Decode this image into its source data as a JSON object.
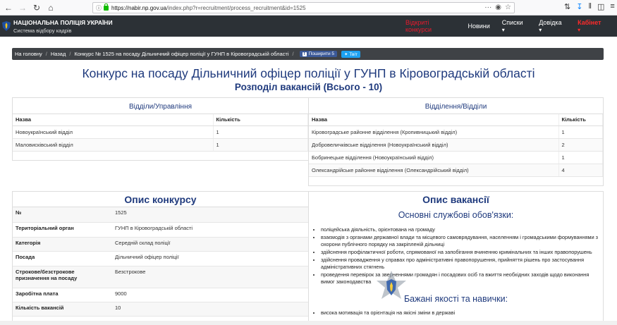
{
  "browser": {
    "url_host": "https://nabir.np.gov.ua",
    "url_path": "/index.php?r=recruitment/process_recruitment&id=1525",
    "url_menu": "···",
    "back_icon": "arrow-left-icon",
    "forward_icon": "arrow-right-icon",
    "reload_icon": "reload-icon",
    "home_icon": "home-icon"
  },
  "site": {
    "title": "НАЦІОНАЛЬНА ПОЛІЦІЯ УКРАЇНИ",
    "subtitle": "Система відбору кадрів",
    "nav": {
      "open_contests": "Відкриті конкурси",
      "news": "Новини",
      "lists": "Списки",
      "help": "Довідка",
      "cabinet": "Кабінет"
    },
    "colors": {
      "header_bg": "#2c3136",
      "active_link": "#e8192c",
      "accent": "#1f3a7d"
    }
  },
  "breadcrumb": {
    "home": "На головну",
    "back": "Назад",
    "current": "Конкурс № 1525 на посаду Дільничний офіцер поліції у ГУНП в Кіровоградській області",
    "fb_share": "Поширити",
    "fb_count": "5",
    "fb_letter": "f",
    "tweet": "Твіт"
  },
  "page_title": "Конкурс на посаду Дільничний офіцер поліції у ГУНП в Кіровоградській області",
  "distribution": {
    "title": "Розподіл вакансій (Всього - 10)",
    "left": {
      "heading": "Відділи/Управління",
      "col_name": "Назва",
      "col_count": "Кількість",
      "rows": [
        {
          "name": "Новоукраїнський відділ",
          "count": "1"
        },
        {
          "name": "Маловисківський відділ",
          "count": "1"
        }
      ]
    },
    "right": {
      "heading": "Відділення/Відділи",
      "col_name": "Назва",
      "col_count": "Кількість",
      "rows": [
        {
          "name": "Кіровоградське районне відділення (Кропивницький відділ)",
          "count": "1"
        },
        {
          "name": "Добровеличківське відділення (Новоукраїнський відділ)",
          "count": "2"
        },
        {
          "name": "Бобринецьке відділення (Новоукраїнський відділ)",
          "count": "1"
        },
        {
          "name": "Олександрійське районне відділення (Олександрійський відділ)",
          "count": "4"
        }
      ]
    }
  },
  "contest": {
    "title": "Опис конкурсу",
    "rows": [
      {
        "label": "№",
        "value": "1525"
      },
      {
        "label": "Територіальний орган",
        "value": "ГУНП в Кіровоградській області"
      },
      {
        "label": "Категорія",
        "value": "Середній склад поліції"
      },
      {
        "label": "Посада",
        "value": "Дільничний офіцер поліції"
      },
      {
        "label": "Строкове/безстрокове призначення на посаду",
        "value": "Безстрокове"
      },
      {
        "label": "Заробітна плата",
        "value": "9000"
      },
      {
        "label": "Кількість вакансій",
        "value": "10"
      }
    ]
  },
  "vacancy": {
    "title": "Опис вакансії",
    "duties_title": "Основні службові обов'язки:",
    "duties": [
      "поліцейська діяльність, орієнтована на громаду",
      "взаємодія з органами державної влади та місцевого самоврядування, населенням і громадськими формуваннями з охорони публічного порядку на закріпленій дільниці",
      "здійснення профілактичної роботи, спрямованої на запобігання вчиненню кримінальних та інших правопорушень",
      "здійснення провадження у справах про адміністративні правопорушення, прийняття рішень про застосування адміністративних стягнень",
      "проведення перевірок за зверненнями громадян і посадових осіб та вжиття необхідних заходів щодо виконання вимог законодавства"
    ],
    "skills_title": "Бажані якості та навички:",
    "skills": [
      "висока мотивація та орієнтація на якісні зміни в державі"
    ]
  }
}
